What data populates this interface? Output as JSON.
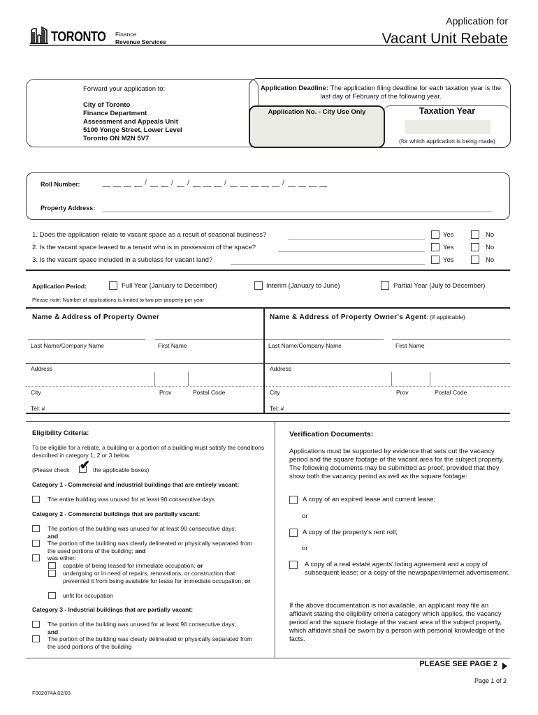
{
  "header": {
    "logo_text": "TORONTO",
    "dept_line1": "Finance",
    "dept_line2": "Revenue Services",
    "app_for": "Application for",
    "app_title": "Vacant Unit Rebate"
  },
  "forward": {
    "label": "Forward your application to:",
    "address": [
      "City of Toronto",
      "Finance Department",
      "Assessment and Appeals Unit",
      "5100 Yonge Street, Lower Level",
      "Toronto ON  M2N 5V7"
    ]
  },
  "deadline": {
    "bold": "Application Deadline:",
    "text": " The application filing deadline for each taxation year is the last day of February of the following year."
  },
  "app_no": {
    "label": "Application No. - City Use Only",
    "value": ""
  },
  "tax_year": {
    "label": "Taxation Year",
    "value": "",
    "note": "(for which application is being made)"
  },
  "roll": {
    "label": "Roll Number:",
    "groups": [
      4,
      2,
      1,
      3,
      5,
      4
    ],
    "separator": "/"
  },
  "property_address": {
    "label": "Property Address:",
    "value": ""
  },
  "questions": [
    {
      "text": "1. Does the application relate to vacant space as a result of seasonal business?",
      "yes": "Yes",
      "no": "No"
    },
    {
      "text": "2. Is the vacant space leased to a tenant who is in possession of the space?",
      "yes": "Yes",
      "no": "No"
    },
    {
      "text": "3. Is the vacant space included in a subclass for vacant land?",
      "yes": "Yes",
      "no": "No"
    }
  ],
  "period": {
    "label": "Application Period:",
    "options": [
      "Full Year (January to December)",
      "Interim (January to June)",
      "Partial Year (July to December)"
    ],
    "note": "Please note:  Number of applications is limited to two per property per year"
  },
  "owner": {
    "heading": "Name & Address of Property Owner",
    "last_name": "Last Name/Company Name",
    "first_name": "First Name",
    "address": "Address",
    "city": "City",
    "prov": "Prov",
    "postal": "Postal Code",
    "tel": "Tel: #"
  },
  "agent": {
    "heading": "Name & Address of Property Owner's Agent",
    "heading_suffix": ": ",
    "heading_note": "(if applicable)",
    "last_name": "Last Name/Company Name",
    "first_name": "First Name",
    "address": "Address",
    "city": "City",
    "prov": "Prov",
    "postal": "Postal Code",
    "tel": "Tel: #"
  },
  "eligibility": {
    "heading": "Eligibility Criteria:",
    "intro": "To be eligible for a rebate, a building or a portion of a building must satisfy the conditions described in category 1, 2 or 3 below.",
    "check_pre": "(Please check",
    "check_post": "the applicable boxes)",
    "cat1": {
      "title": "Category 1 - Commercial and industrial buildings that are entirely vacant:",
      "items": [
        "The entire building was unused for at least 90 consecutive days"
      ]
    },
    "cat2": {
      "title": "Category 2 - Commercial buildings that are partially vacant:",
      "item1": "The portion of the building was unused for at least 90 consecutive days;",
      "item1_and": "and",
      "item2": "The portion of the building was clearly delineated or physically separated from the used portions of the building;",
      "item2_and": "and",
      "item3": "was either:",
      "sub1": "capable of being leased for immediate occupation;",
      "sub1_or": "or",
      "sub2": "undergoing or in need of repairs, renovations, or construction that prevented it from being available for lease for immediate occupation;",
      "sub2_or": "or",
      "sub3": "unfit for occupation"
    },
    "cat3": {
      "title": "Category 3 - Industrial buildings that are partially vacant:",
      "item1": "The portion of the building was unused for at least 90 consecutive days;",
      "item1_and": "and",
      "item2": "The portion of the building was clearly delineated or physically separated from the used portions of the building"
    }
  },
  "verification": {
    "heading": "Verification Documents:",
    "intro": "Applications must be supported by evidence that sets out the vacancy period and the square footage of the vacant area for the subject property. The following documents may be submitted as proof, provided that they show both the vacancy period as well as the square footage:",
    "doc1": "A copy of an expired lease and current lease;",
    "or1": "or",
    "doc2": "A copy of the property's rent roll;",
    "or2": "or",
    "doc3": "A copy of a real estate agents' listing agreement and a copy of subsequent lease; or a copy of the newspaper/internet advertisement.",
    "affidavit": "If the above documentation is not available, an applicant may file an affidavit stating the eligibility criteria category which applies, the vacancy period and the square footage of the vacant area of the subject property, which affidavit shall be sworn by a person with personal knowledge of the facts."
  },
  "footer": {
    "see_page": "PLEASE SEE PAGE 2",
    "page_num": "Page 1 of 2",
    "form_code": "F002074A 02/03"
  }
}
